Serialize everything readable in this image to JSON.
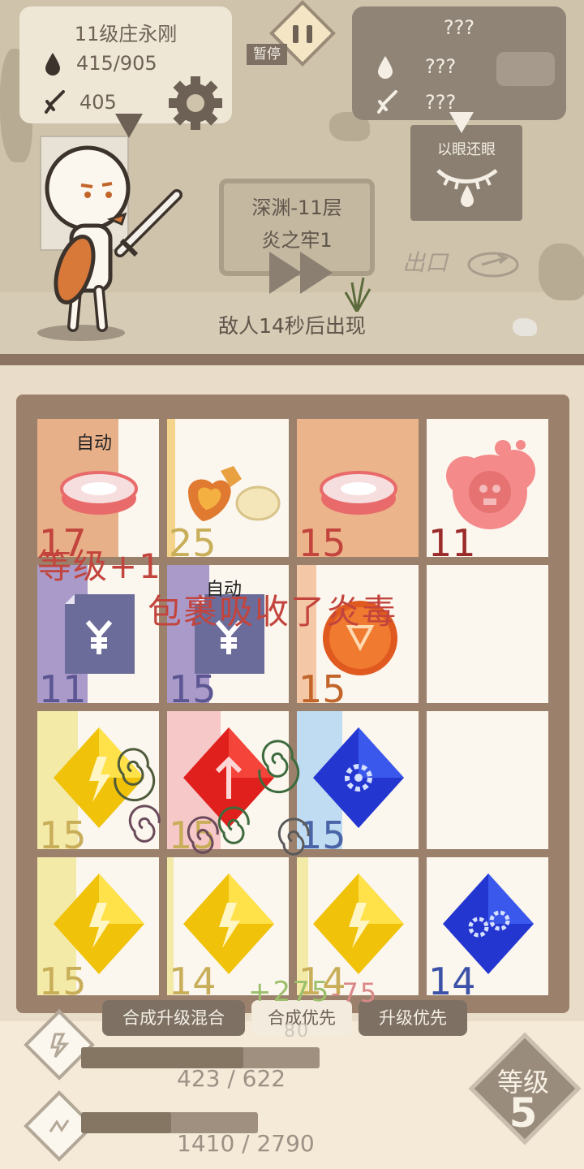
{
  "player": {
    "name": "11级庄永刚",
    "hp": "415/905",
    "attack": "405"
  },
  "enemy": {
    "name": "???",
    "hp": "???",
    "attack": "???"
  },
  "pause": {
    "label": "暂停"
  },
  "stage": {
    "line1": "深渊-11层",
    "line2": "炎之牢1"
  },
  "spawn_notice": "敌人14秒后出现",
  "skill": {
    "name": "以眼还眼"
  },
  "exit_label": "出口",
  "board": {
    "tiles": [
      {
        "level": "17",
        "auto": "自动",
        "icon": "meat-icon",
        "color": "#e8b089",
        "lvl_color": "#c2443d"
      },
      {
        "level": "25",
        "auto": "",
        "icon": "gold-nuggets-icon",
        "color": "#f4d38b",
        "lvl_color": "#c9ae5a"
      },
      {
        "level": "15",
        "auto": "",
        "icon": "meat-icon",
        "color": "#ebb48b",
        "lvl_color": "#c2443d"
      },
      {
        "level": "11",
        "auto": "",
        "icon": "poison-cloud-icon",
        "color": "#fbf6ee",
        "lvl_color": "#9b2a2a"
      },
      {
        "level": "11",
        "auto": "",
        "icon": "money-bill-icon",
        "color": "#a99ac9",
        "lvl_color": "#5b5591"
      },
      {
        "level": "15",
        "auto": "自动",
        "icon": "money-bill-icon",
        "color": "#a99ac9",
        "lvl_color": "#5b5591"
      },
      {
        "level": "15",
        "auto": "",
        "icon": "coin-icon",
        "color": "#f4c8a6",
        "lvl_color": "#c2652a"
      },
      {
        "level": "",
        "auto": "",
        "icon": "",
        "color": "#fbf6ee",
        "lvl_color": "#000"
      },
      {
        "level": "15",
        "auto": "",
        "icon": "lightning-gem-icon",
        "color": "#f3eaa8",
        "lvl_color": "#c9ae5a"
      },
      {
        "level": "15",
        "auto": "",
        "icon": "arrow-up-gem-icon",
        "color": "#f6c8c8",
        "lvl_color": "#c9ae5a"
      },
      {
        "level": "15",
        "auto": "",
        "icon": "gear-gem-icon",
        "color": "#bfdcf3",
        "lvl_color": "#4a64a8"
      },
      {
        "level": "",
        "auto": "",
        "icon": "",
        "color": "#fbf6ee",
        "lvl_color": "#000"
      },
      {
        "level": "15",
        "auto": "",
        "icon": "lightning-gem-icon",
        "color": "#f3eaa8",
        "lvl_color": "#c9ae5a"
      },
      {
        "level": "14",
        "auto": "",
        "icon": "lightning-gem-icon",
        "color": "#f3eaa8",
        "lvl_color": "#c9ae5a"
      },
      {
        "level": "14",
        "auto": "",
        "icon": "lightning-gem-icon",
        "color": "#f3eaa8",
        "lvl_color": "#c9ae5a"
      },
      {
        "level": "14",
        "auto": "",
        "icon": "double-gear-gem-icon",
        "color": "#fbf6ee",
        "lvl_color": "#3b52a8"
      }
    ]
  },
  "floating": {
    "level_up": "等级+1",
    "absorb": "包裹吸收了炎毒",
    "score_plus": "+275",
    "score_minus": "-75",
    "faint": "80"
  },
  "modes": [
    {
      "label": "合成升级混合"
    },
    {
      "label": "合成优先"
    },
    {
      "label": "升级优先"
    }
  ],
  "progress": [
    {
      "label": "423 / 622",
      "fraction": 0.68
    },
    {
      "label": "1410 / 2790",
      "fraction": 0.51
    }
  ],
  "level_badge": {
    "label": "等级",
    "value": "5"
  }
}
